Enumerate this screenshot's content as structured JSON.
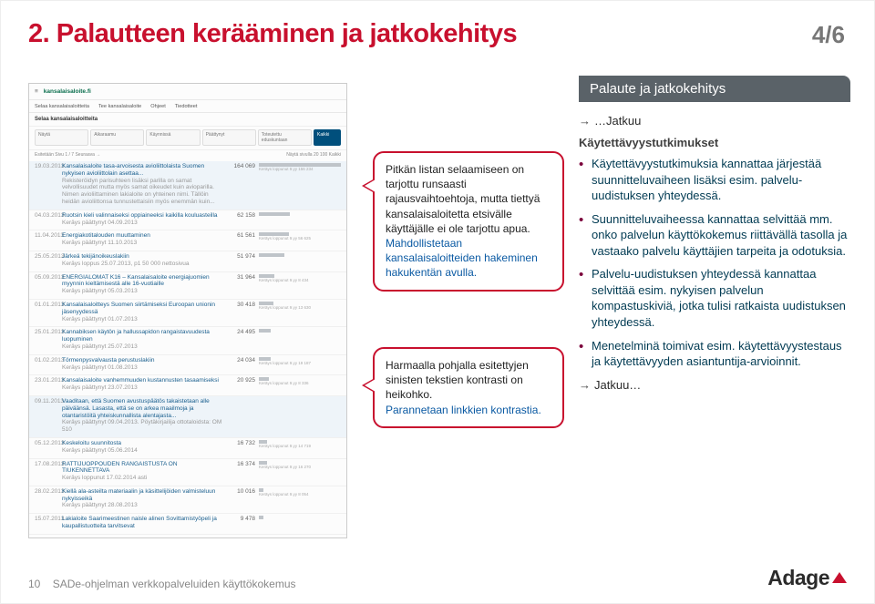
{
  "title": "2. Palautteen kerääminen ja jatkokehitys",
  "page_indicator": "4/6",
  "screenshot": {
    "logo": "kansalaisaloite.fi",
    "tabs": [
      "Selaa kansalaisaloitteita",
      "Tee kansalaisaloite",
      "Ohjeet",
      "Tiedotteet"
    ],
    "search_heading": "Selaa kansalaisaloitteita",
    "filters": [
      "Näytä",
      "Aikaraamu",
      "Käynnissä",
      "Päättynyt",
      "Toteutettu eduskuntaan",
      "Kaikki"
    ],
    "meta_left": "Esitetään  Sivu 1 / 7   Seuraava →",
    "meta_right": "Näytä sivulla  20  100  Kaikki",
    "rows": [
      {
        "date": "19.03.2013",
        "title": "Kansalaisaloite tasa-arvoisesta avioliittolaista Suomen nykyisen avioliittolain asettaa...",
        "sub": "Rekisteröidyn parisuhteen lisäksi parilla on samat velvollisuudet mutta myös samat oikeudet kuin avioparilla. Nimen avioliittaminen lakialoite on yhteinen nimi. Tällöin heidän avioliittonsa tunnustettaisiin myös enemmän kuin...",
        "num": "164 069",
        "sub2": "Keräys loppunut 9.yy 156 234",
        "bar": 100,
        "hl": true
      },
      {
        "date": "04.03.2013",
        "title": "Ruotsin kieli valinnaiseksi oppiaineeksi kaikilla kouluasteilla",
        "sub": "Keräys päättynyt 04.09.2013",
        "num": "62 158",
        "bar": 38
      },
      {
        "date": "11.04.2013",
        "title": "Energiakotitalouden muuttaminen",
        "sub": "Keräys päättynyt 11.10.2013",
        "num": "61 561",
        "sub2": "Keräys loppunut 9.yy 56 625",
        "bar": 37
      },
      {
        "date": "25.05.2013",
        "title": "Järkeä tekijänoikeuslakiin",
        "sub": "Keräys loppus 25.07.2013, p1 50 000 nettosivua",
        "num": "51 974",
        "bar": 31
      },
      {
        "date": "05.09.2013",
        "title": "ENERGIALOMAT K16 – Kansalaisaloite energiajuomien myynnin kieltämisestä alle 16-vuotiaille",
        "sub": "Keräys päättynyt 05.03.2013",
        "num": "31 964",
        "sub2": "Keräys loppunut 9.yy 8 434",
        "bar": 19
      },
      {
        "date": "01.01.2013",
        "title": "Kansalaisaloitteys Suomen siirtämiseksi Euroopan unionin jäsenyydessä",
        "sub": "Keräys päättynyt 01.07.2013",
        "num": "30 418",
        "sub2": "Keräys loppunut 9.yy 13 630",
        "bar": 18
      },
      {
        "date": "25.01.2013",
        "title": "Kannabiksen käytön ja hallussapidon rangaistavuudesta luopuminen",
        "sub": "Keräys päättynyt 25.07.2013",
        "num": "24 495",
        "bar": 14
      },
      {
        "date": "01.02.2013",
        "title": "Törmenpysvalvausta perustuslakiin",
        "sub": "Keräys päättynyt 01.08.2013",
        "num": "24 034",
        "sub2": "Keräys loppunut 9.yy 19 187",
        "bar": 14
      },
      {
        "date": "23.01.2013",
        "title": "Kansalaisaloite vanhemmuuden kustannusten tasaamiseksi",
        "sub": "Keräys päättynyt 23.07.2013",
        "num": "20 925",
        "sub2": "Keräys loppunut 9.yy 8 336",
        "bar": 12
      },
      {
        "date": "09.11.2013",
        "title": "Vaaditaan, että Suomen avustuspäätös takaistetaan alle päiväänsä. Lasasta, että se on arkea maailmoja ja otantaristöitä yhteiskunnallista alentajasta...",
        "sub": "Keräys päättynyt 09.04.2013. Pöytäkirjailija ottotaloidsta: OM 510",
        "num": "",
        "bar": 0,
        "hl": true
      },
      {
        "date": "05.12.2013",
        "title": "Keskeloitu suunnitosta",
        "sub": "Keräys päättynyt 05.06.2014",
        "num": "16 732",
        "sub2": "Keräys loppunut 9.yy 14 719",
        "bar": 10
      },
      {
        "date": "17.08.2013",
        "title": "RATTIJUOPPOUDEN RANGAISTUSTA ON TIUKENNETTAVA",
        "sub": "Keräys loppunut 17.02.2014 asti",
        "num": "16 374",
        "sub2": "Keräys loppunut 9.yy 16 270",
        "bar": 10
      },
      {
        "date": "28.02.2013",
        "title": "Kiellä ala-asteilta materiaalin ja käsittelijöiden valmisteluun nykyisseikä",
        "sub": "Keräys päättynyt 28.08.2013",
        "num": "10 016",
        "sub2": "Keräys loppunut 9.yy 8 054",
        "bar": 6
      },
      {
        "date": "15.07.2013",
        "title": "Lakialoite Saarimeestinen naisle alinen Sovittamistyöpeli ja kaupallistuotteita tarvitsevat",
        "num": "9 478",
        "bar": 5
      }
    ]
  },
  "callout1": {
    "para1": "Pitkän listan selaamiseen on tarjottu runsaasti rajausvaihtoehtoja, mutta tiettyä kansalaisaloitetta etsivälle käyttäjälle ei ole tarjottu apua.",
    "blue": "Mahdollistetaan kansalaisaloitteiden hakeminen hakukentän avulla."
  },
  "callout2": {
    "para1": "Harmaalla pohjalla esitettyjen sinisten tekstien kontrasti on heikohko.",
    "blue": "Parannetaan linkkien kontrastia."
  },
  "right": {
    "header": "Palaute ja jatkokehitys",
    "jatkuu_top": "…Jatkuu",
    "subhead": "Käytettävyystutkimukset",
    "bullets": [
      "Käytettävyystutkimuksia kannattaa järjestää suunnitteluvaiheen lisäksi esim. palvelu-uudistuksen yhteydessä.",
      "Suunnitteluvaiheessa kannattaa selvittää mm. onko palvelun käyttökokemus riittävällä tasolla ja vastaako palvelu käyttäjien tarpeita ja odotuksia.",
      "Palvelu-uudistuksen yhteydessä kannattaa selvittää esim. nykyisen palvelun kompastuskiviä, jotka tulisi ratkaista uudistuksen yhteydessä.",
      "Menetelminä toimivat esim. käytettävyystestaus ja käytettävyyden asiantuntija-arvioinnit."
    ],
    "jatkuu_bottom": "Jatkuu…"
  },
  "footer": {
    "page": "10",
    "doc": "SADe-ohjelman verkkopalveluiden käyttökokemus",
    "brand": "Adage"
  }
}
